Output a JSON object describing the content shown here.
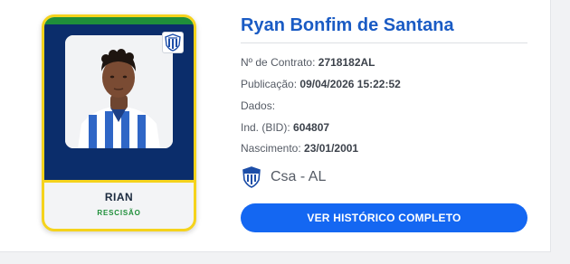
{
  "card": {
    "nickname": "RIAN",
    "status": "RESCISÃO",
    "photo_icon": "player-photo",
    "club_badge_icon": "csa-badge-icon"
  },
  "player": {
    "full_name": "Ryan Bonfim de Santana",
    "contract_label": "Nº de Contrato:",
    "contract_value": "2718182AL",
    "publication_label": "Publicação:",
    "publication_value": "09/04/2026 15:22:52",
    "data_label": "Dados:",
    "bid_label": "Ind. (BID):",
    "bid_value": "604807",
    "birth_label": "Nascimento:",
    "birth_value": "23/01/2001"
  },
  "club": {
    "name": "Csa - AL",
    "icon": "csa-badge-icon"
  },
  "actions": {
    "history_button": "VER HISTÓRICO COMPLETO"
  },
  "colors": {
    "accent_blue": "#1467f2",
    "name_blue": "#1a5bc4",
    "card_navy": "#0b2d6b",
    "card_yellow": "#f5d31c",
    "status_green": "#1f8f3a"
  }
}
